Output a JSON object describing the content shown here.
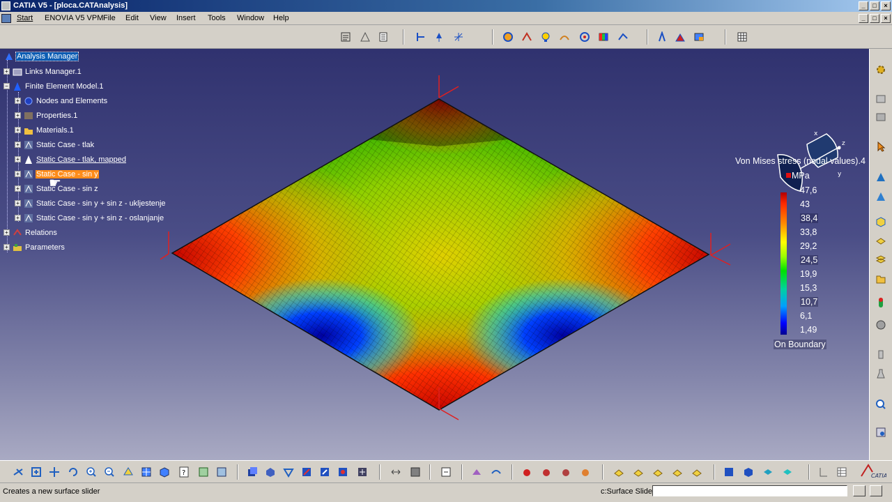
{
  "window": {
    "title": "CATIA V5 - [ploca.CATAnalysis]",
    "min": "_",
    "max": "□",
    "close": "×"
  },
  "menu": {
    "items": [
      "Start",
      "ENOVIA V5 VPM",
      "File",
      "Edit",
      "View",
      "Insert",
      "Tools",
      "Window",
      "Help"
    ]
  },
  "tree": {
    "root": "Analysis Manager",
    "links_manager": "Links Manager.1",
    "fem": "Finite Element Model.1",
    "nodes": "Nodes and Elements",
    "properties": "Properties.1",
    "materials": "Materials.1",
    "case_tlak": "Static Case - tlak",
    "case_tlak_mapped": "Static Case - tlak, mapped",
    "case_sin_y": "Static Case - sin y",
    "case_sin_z": "Static Case - sin z",
    "case_uklj": "Static Case - sin y + sin z - ukljestenje",
    "case_oslanj": "Static Case - sin y + sin z - oslanjanje",
    "relations": "Relations",
    "parameters": "Parameters"
  },
  "legend": {
    "title": "Von Mises stress (nodal values).4",
    "unit": "MPa",
    "values": [
      "47,6",
      "43",
      "38,4",
      "33,8",
      "29,2",
      "24,5",
      "19,9",
      "15,3",
      "10,7",
      "6,1",
      "1,49"
    ],
    "footer": "On Boundary"
  },
  "colors": {
    "viewport_top": "#30326f",
    "viewport_bottom": "#a9aac3",
    "selection": "#ff8c1a",
    "tree_root_highlight": "#0a5cb3"
  },
  "status": {
    "message": "Creates a new surface slider",
    "prompt_label": "c:Surface Slider",
    "prompt_value": ""
  },
  "toolbar_top_icons": [
    "analysis-icon",
    "mesh-icon",
    "sheet-icon",
    "restraint-icon",
    "pin-icon",
    "gimbal-icon",
    "compute-icon",
    "pressure-icon",
    "sensor-icon",
    "deformation-icon",
    "stress-icon",
    "palette-icon",
    "animate-icon",
    "report-icon",
    "cut-plane-icon",
    "image-icon",
    "calculator-icon"
  ],
  "toolbar_right_icons": [
    "settings-icon",
    "layers-icon",
    "filter-icon",
    "cursor-icon",
    "cone-icon",
    "cone-2-icon",
    "cube-icon",
    "plate-icon",
    "stack-icon",
    "folder-icon",
    "sensor-icon",
    "sphere-icon",
    "bottle-icon",
    "flask-icon",
    "zoom-icon",
    "report-icon"
  ],
  "toolbar_bottom_icons": [
    "fly-icon",
    "fit-all-icon",
    "pan-icon",
    "rotate-icon",
    "zoom-in-icon",
    "zoom-out-icon",
    "normal-view-icon",
    "iso-view-icon",
    "cube-view-icon",
    "help-icon",
    "hide-show-icon",
    "swap-icon",
    "material-icon",
    "tree-icon",
    "edge-icon",
    "cut-icon",
    "link-icon",
    "compare-icon",
    "measure-icon",
    "grid-icon",
    "render-icon",
    "light-icon",
    "shadow-icon",
    "surface-1-icon",
    "surface-2-icon",
    "surface-3-icon",
    "surface-4-icon",
    "surface-5-icon",
    "box-1-icon",
    "box-2-icon",
    "box-3-icon",
    "box-4-icon",
    "arrow-icon",
    "table-icon",
    "catia-logo-icon"
  ]
}
